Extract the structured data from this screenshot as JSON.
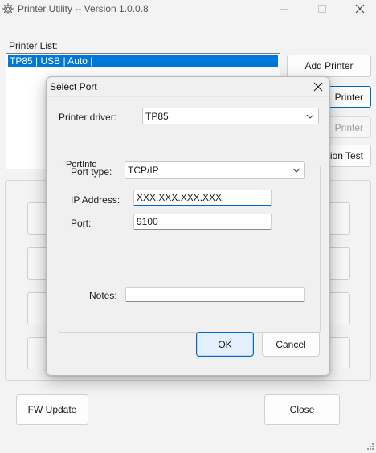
{
  "window": {
    "title": "Printer Utility -- Version 1.0.0.8",
    "icons": {
      "app": "gear-icon",
      "minimize": "minimize-icon",
      "maximize": "maximize-icon",
      "close": "close-icon"
    }
  },
  "main": {
    "printer_list_label": "Printer List:",
    "printer_list": [
      {
        "text": "TP85 | USB | Auto |",
        "selected": true
      }
    ],
    "buttons": {
      "add_printer": "Add Printer",
      "edit_printer_visible": "Printer",
      "remove_printer_visible": "Printer",
      "test_visible": "ion Test",
      "fw_update": "FW Update",
      "close": "Close"
    }
  },
  "dialog": {
    "title": "Select Port",
    "printer_driver_label": "Printer driver:",
    "printer_driver_value": "TP85",
    "portinfo_label": "PortInfo",
    "port_type_label": "Port type:",
    "port_type_value": "TCP/IP",
    "ip_label": "IP Address:",
    "ip_value": "XXX.XXX.XXX.XXX",
    "port_label": "Port:",
    "port_value": "9100",
    "notes_label": "Notes:",
    "notes_value": "",
    "ok": "OK",
    "cancel": "Cancel"
  },
  "colors": {
    "accent": "#0078d7",
    "focus_border": "#0067c0",
    "disabled_text": "#a0a0a0"
  }
}
